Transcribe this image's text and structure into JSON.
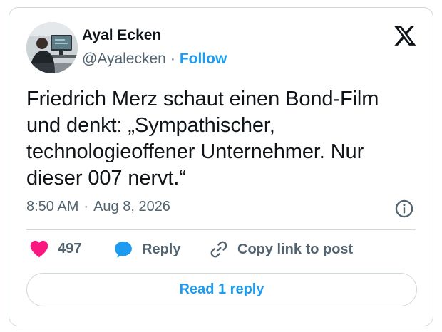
{
  "author": {
    "name": "Ayal Ecken",
    "handle": "@Ayalecken",
    "separator": "·",
    "follow_label": "Follow"
  },
  "tweet": {
    "lines": [
      "Friedrich Merz schaut einen Bond-Film",
      "und denkt: „Sympathischer,",
      "technologieoffener Unternehmer. Nur",
      "dieser 007 nervt.“"
    ],
    "time": "8:50 AM",
    "separator": "·",
    "date": "Aug 8, 2026"
  },
  "actions": {
    "like_count": "497",
    "reply_label": "Reply",
    "copy_label": "Copy link to post"
  },
  "read_reply_label": "Read 1 reply",
  "icons": {
    "brand": "x-logo-icon",
    "info": "info-icon",
    "like": "heart-icon",
    "reply": "speech-bubble-icon",
    "copy": "link-icon"
  },
  "colors": {
    "accent": "#1d9bf0",
    "heart": "#f91880",
    "text": "#0f1419",
    "muted": "#536471",
    "border": "#cfd9de"
  }
}
